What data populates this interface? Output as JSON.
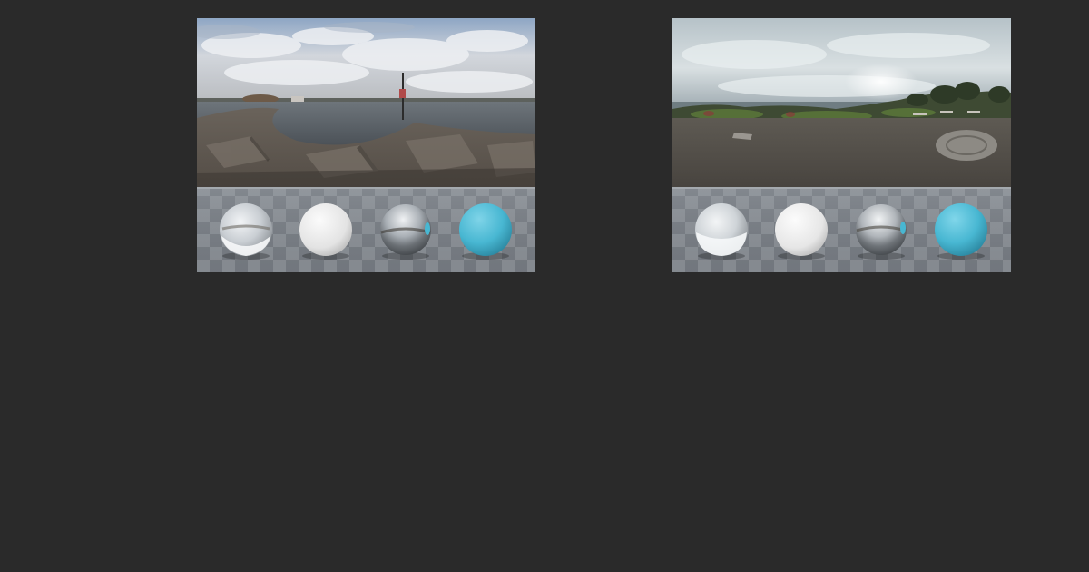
{
  "page": {
    "background": "#2a2a2a"
  },
  "hdri_previews": [
    {
      "scene": "rocky-pier-lake",
      "icon": "hdri-thumbnail",
      "spheres": [
        "glass-sphere",
        "white-matte-sphere",
        "chrome-sphere",
        "blue-sphere"
      ]
    },
    {
      "scene": "coastal-park-overlook",
      "icon": "hdri-thumbnail",
      "spheres": [
        "glass-sphere",
        "white-matte-sphere",
        "chrome-sphere",
        "blue-sphere"
      ]
    }
  ],
  "colors": {
    "blue_sphere": "#48b7d2",
    "white_sphere": "#e9e9e9",
    "checker_light": "#8e9399",
    "checker_dark": "#767b82"
  }
}
